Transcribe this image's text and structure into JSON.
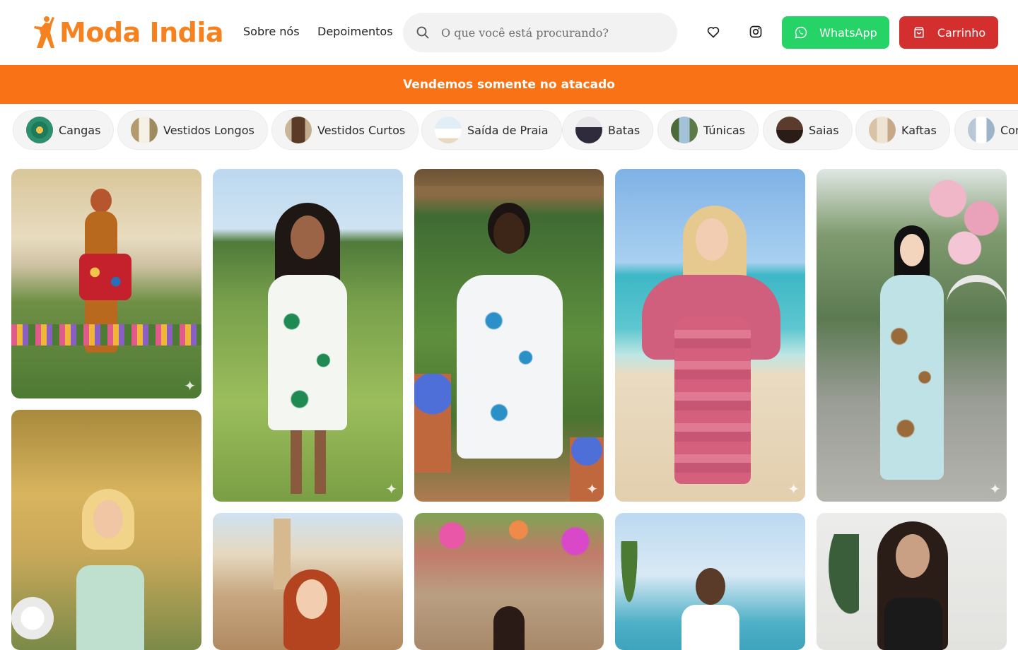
{
  "header": {
    "logo_text": "Moda India",
    "nav": [
      {
        "label": "Sobre nós"
      },
      {
        "label": "Depoimentos"
      }
    ],
    "search_placeholder": "O que você está procurando?",
    "whatsapp_label": "WhatsApp",
    "cart_label": "Carrinho"
  },
  "banner": {
    "text": "Vendemos somente no atacado"
  },
  "categories": [
    {
      "label": "Cangas"
    },
    {
      "label": "Vestidos Longos"
    },
    {
      "label": "Vestidos Curtos"
    },
    {
      "label": "Saída de Praia"
    },
    {
      "label": "Batas"
    },
    {
      "label": "Túnicas"
    },
    {
      "label": "Saias"
    },
    {
      "label": "Kaftas"
    },
    {
      "label": "Conjuntos"
    }
  ],
  "colors": {
    "brand_orange": "#f5821f",
    "banner_orange": "#f97316",
    "whatsapp_green": "#25d366",
    "cart_red": "#d32f2f"
  },
  "icons": [
    "search-icon",
    "heart-icon",
    "instagram-icon",
    "whatsapp-icon",
    "shopping-bag-icon",
    "sparkle-icon"
  ]
}
